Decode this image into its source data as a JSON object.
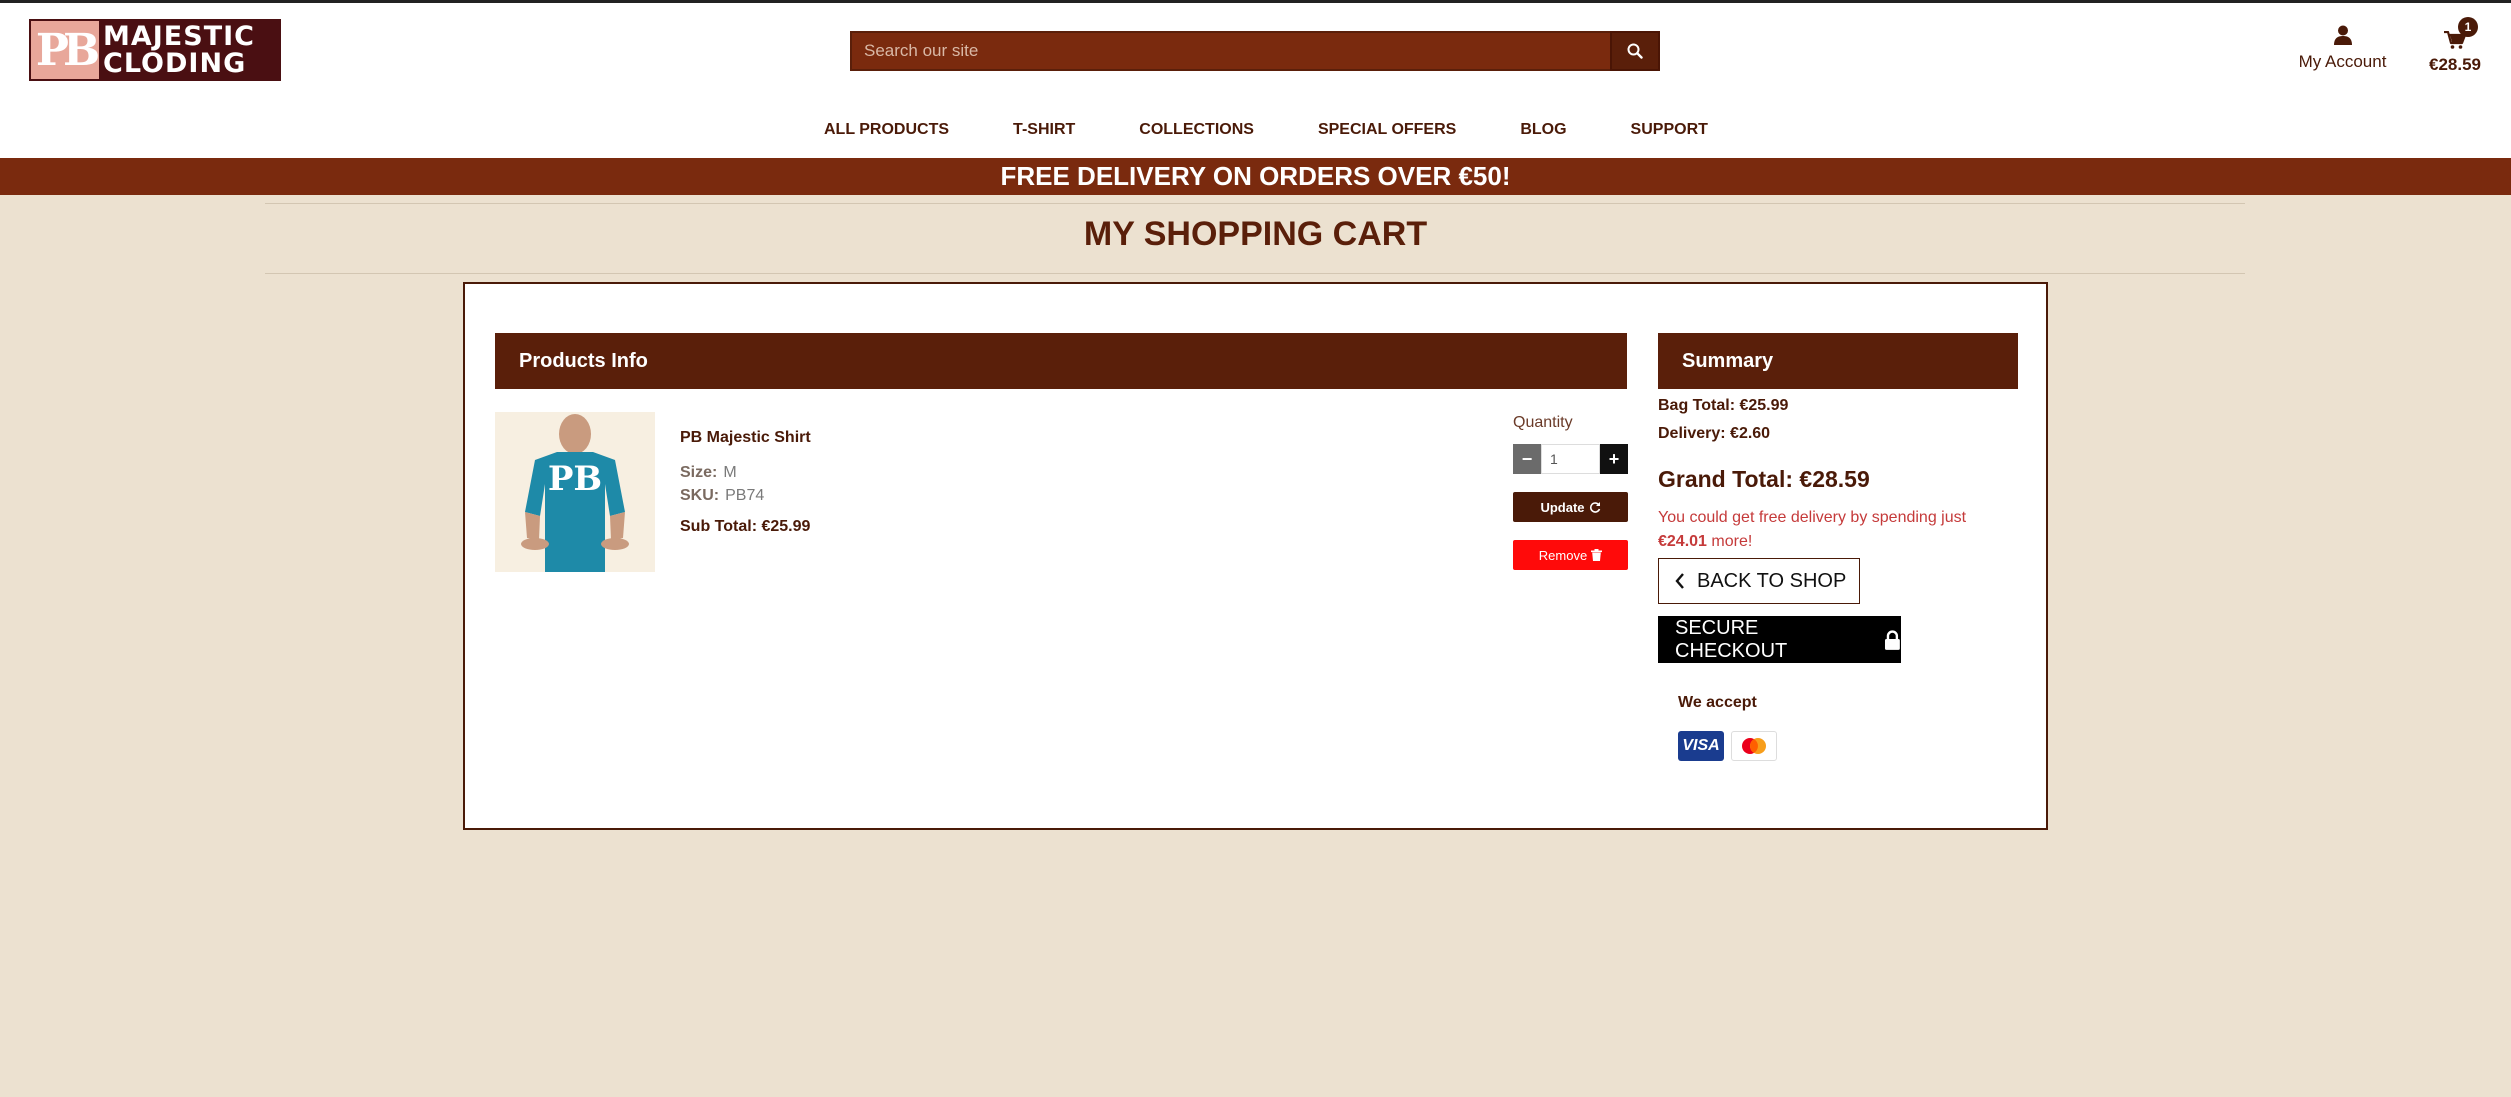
{
  "header": {
    "logo_line1": "MAJESTIC",
    "logo_line2": "CLODING",
    "logo_mark": "PB",
    "search_placeholder": "Search our site",
    "account_label": "My Account",
    "cart_count": "1",
    "cart_total": "€28.59",
    "icons": {
      "search": "search-icon",
      "account": "user-icon",
      "cart": "cart-icon"
    }
  },
  "nav": {
    "items": [
      "ALL PRODUCTS",
      "T-SHIRT",
      "COLLECTIONS",
      "SPECIAL OFFERS",
      "BLOG",
      "SUPPORT"
    ]
  },
  "banner": {
    "text": "FREE DELIVERY ON ORDERS OVER €50!"
  },
  "page": {
    "title": "MY SHOPPING CART"
  },
  "products": {
    "heading": "Products Info",
    "item": {
      "name": "PB Majestic Shirt",
      "size_label": "Size:",
      "size_value": "M",
      "sku_label": "SKU:",
      "sku_value": "PB74",
      "subtotal": "Sub Total: €25.99",
      "quantity_label": "Quantity",
      "quantity_value": "1",
      "update_label": "Update",
      "remove_label": "Remove"
    }
  },
  "summary": {
    "heading": "Summary",
    "bag_total": "Bag Total: €25.99",
    "delivery": "Delivery: €2.60",
    "grand_total": "Grand Total: €28.59",
    "free_msg_prefix": "You could get free delivery by spending just",
    "free_msg_amount": "€24.01",
    "free_msg_suffix": "more!",
    "back_label": "BACK TO SHOP",
    "checkout_label": "SECURE CHECKOUT",
    "we_accept": "We accept",
    "card_visa": "VISA"
  },
  "colors": {
    "brand_dark": "#5a1f0a",
    "brand": "#7a2a0e",
    "page_bg": "#ece1d0",
    "remove_red": "#ff0a0a",
    "alert_red": "#c53a3a"
  }
}
